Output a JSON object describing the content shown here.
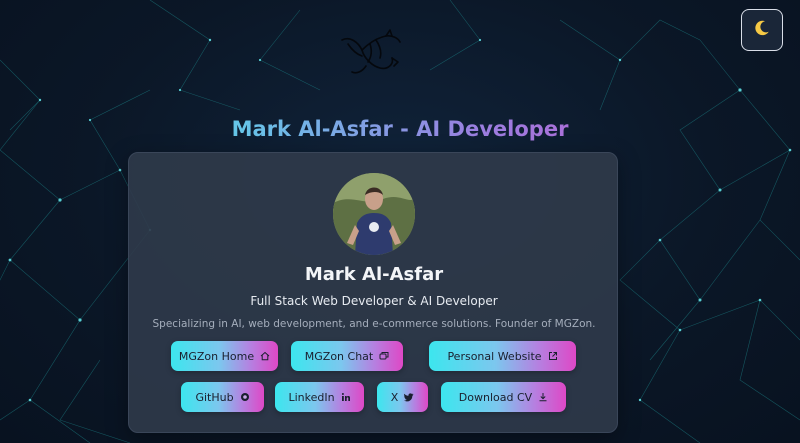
{
  "header": {
    "title": "Mark Al-Asfar - AI Developer",
    "logo_icon": "dragon-logo-icon",
    "theme_toggle_icon": "moon-icon"
  },
  "profile": {
    "name": "Mark Al-Asfar",
    "role": "Full Stack Web Developer & AI Developer",
    "bio": "Specializing in AI, web development, and e-commerce solutions. Founder of MGZon.",
    "avatar_icon": "profile-photo"
  },
  "links": {
    "row1": [
      {
        "label": "MGZon Home",
        "icon": "home-icon"
      },
      {
        "label": "MGZon Chat",
        "icon": "chat-icon"
      },
      {
        "label": "Personal Website",
        "icon": "external-link-icon"
      }
    ],
    "row2": [
      {
        "label": "GitHub",
        "icon": "github-icon"
      },
      {
        "label": "LinkedIn",
        "icon": "linkedin-icon"
      },
      {
        "label": "X",
        "icon": "twitter-icon"
      },
      {
        "label": "Download CV",
        "icon": "download-icon"
      }
    ]
  },
  "colors": {
    "background": "#0b1627",
    "card": "#2f3a4a",
    "network_lines": "#1d8a8e",
    "button_gradient_start": "#3ce6ee",
    "button_gradient_end": "#de48c6"
  }
}
